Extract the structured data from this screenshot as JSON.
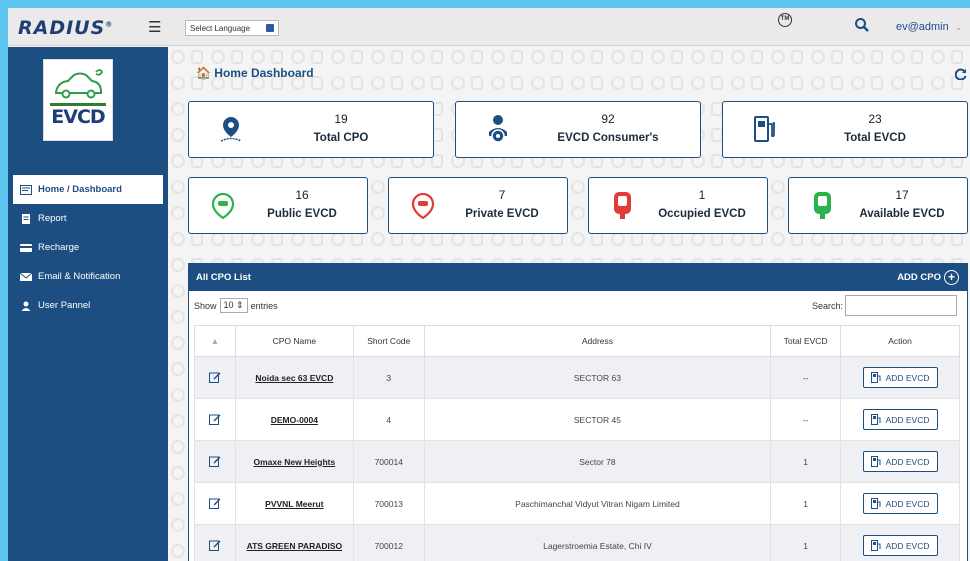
{
  "header": {
    "logo": "RADIUS",
    "language_select": "Select Language",
    "user": "ev@admin"
  },
  "sidebar": {
    "brand": "EVCD",
    "items": [
      {
        "label": "Home / Dashboard",
        "icon": "dashboard-icon",
        "active": true
      },
      {
        "label": "Report",
        "icon": "report-icon"
      },
      {
        "label": "Recharge",
        "icon": "card-icon"
      },
      {
        "label": "Email & Notification",
        "icon": "mail-icon"
      },
      {
        "label": "User Pannel",
        "icon": "user-icon"
      }
    ]
  },
  "main": {
    "title": "Home Dashboard",
    "stats_top": [
      {
        "value": "19",
        "label": "Total CPO",
        "icon": "location-pin-icon"
      },
      {
        "value": "92",
        "label": "EVCD Consumer's",
        "icon": "driver-icon"
      },
      {
        "value": "23",
        "label": "Total EVCD",
        "icon": "fuel-pump-icon"
      }
    ],
    "stats_bottom": [
      {
        "value": "16",
        "label": "Public EVCD",
        "icon": "public-pin-icon",
        "color": "#2bb34b"
      },
      {
        "value": "7",
        "label": "Private EVCD",
        "icon": "private-pin-icon",
        "color": "#e53935"
      },
      {
        "value": "1",
        "label": "Occupied EVCD",
        "icon": "occupied-charger-icon",
        "color": "#e53935"
      },
      {
        "value": "17",
        "label": "Available EVCD",
        "icon": "available-charger-icon",
        "color": "#2bb34b"
      }
    ]
  },
  "cpo_list": {
    "title": "All CPO List",
    "add_label": "ADD CPO",
    "show_label": "Show",
    "entries_value": "10",
    "entries_label": "entries",
    "search_label": "Search:",
    "columns": [
      "▲",
      "CPO Name",
      "Short Code",
      "Address",
      "Total EVCD",
      "Action"
    ],
    "action_label": "ADD EVCD",
    "rows": [
      {
        "name": "Noida sec 63 EVCD",
        "code": "3",
        "address": "SECTOR 63",
        "total": "--"
      },
      {
        "name": "DEMO-0004",
        "code": "4",
        "address": "SECTOR 45",
        "total": "--"
      },
      {
        "name": "Omaxe New Heights",
        "code": "700014",
        "address": "Sector 78",
        "total": "1"
      },
      {
        "name": "PVVNL Meerut",
        "code": "700013",
        "address": "Paschimanchal Vidyut Vitran Nigam Limited",
        "total": "1"
      },
      {
        "name": "ATS GREEN PARADISO",
        "code": "700012",
        "address": "Lagerstroemia Estate, Chi IV",
        "total": "1"
      }
    ]
  }
}
